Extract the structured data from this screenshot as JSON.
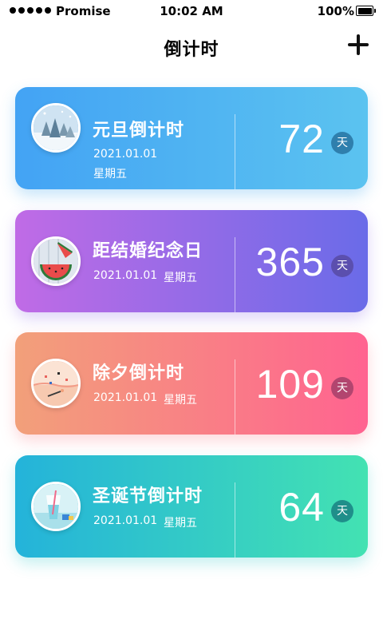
{
  "status_bar": {
    "carrier": "Promise",
    "time": "10:02 AM",
    "battery": "100%"
  },
  "nav": {
    "title": "倒计时",
    "add_icon": "plus-icon"
  },
  "cards": [
    {
      "title": "元旦倒计时",
      "date": "2021.01.01",
      "weekday": "星期五",
      "count": "72",
      "unit": "天",
      "avatar": "snowy-forest-icon",
      "gradient": [
        "#43a3f4",
        "#5bc3f0"
      ]
    },
    {
      "title": "距结婚纪念日",
      "date": "2021.01.01",
      "weekday": "星期五",
      "count": "365",
      "unit": "天",
      "avatar": "watermelon-icon",
      "gradient": [
        "#c06be6",
        "#6a6be8"
      ]
    },
    {
      "title": "除夕倒计时",
      "date": "2021.01.01",
      "weekday": "星期五",
      "count": "109",
      "unit": "天",
      "avatar": "beach-icon",
      "gradient": [
        "#f2a07a",
        "#ff6390"
      ]
    },
    {
      "title": "圣诞节倒计时",
      "date": "2021.01.01",
      "weekday": "星期五",
      "count": "64",
      "unit": "天",
      "avatar": "glass-drink-icon",
      "gradient": [
        "#24b3da",
        "#43e2b2"
      ]
    }
  ]
}
